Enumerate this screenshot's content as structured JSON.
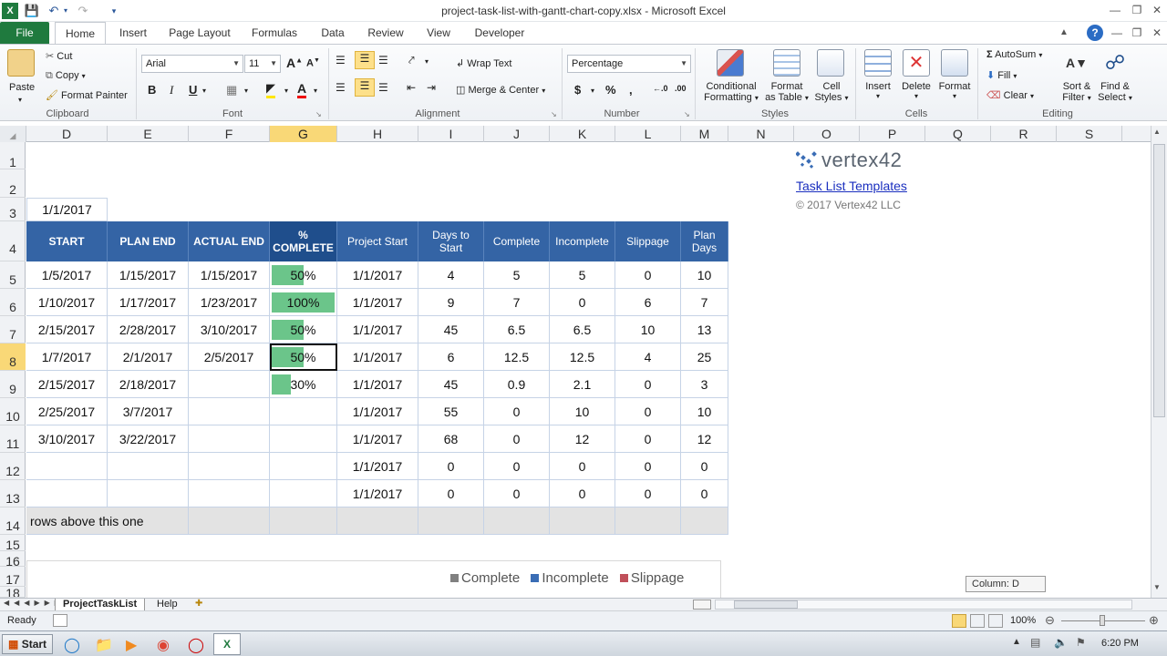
{
  "window": {
    "title": "project-task-list-with-gantt-chart-copy.xlsx - Microsoft Excel"
  },
  "ribbon_tabs": [
    "File",
    "Home",
    "Insert",
    "Page Layout",
    "Formulas",
    "Data",
    "Review",
    "View",
    "Developer"
  ],
  "ribbon": {
    "clipboard": {
      "paste": "Paste",
      "cut": "Cut",
      "copy": "Copy",
      "format_painter": "Format Painter",
      "label": "Clipboard"
    },
    "font": {
      "name": "Arial",
      "size": "11",
      "label": "Font"
    },
    "alignment": {
      "wrap_text": "Wrap Text",
      "merge_center": "Merge & Center",
      "label": "Alignment"
    },
    "number": {
      "format": "Percentage",
      "label": "Number"
    },
    "styles": {
      "conditional": "Conditional",
      "conditional2": "Formatting",
      "format_as": "Format",
      "format_as2": "as Table",
      "cell": "Cell",
      "cell2": "Styles",
      "label": "Styles"
    },
    "cells": {
      "insert": "Insert",
      "delete": "Delete",
      "format": "Format",
      "label": "Cells"
    },
    "editing": {
      "autosum": "AutoSum",
      "fill": "Fill",
      "clear": "Clear",
      "sort": "Sort &",
      "sort2": "Filter",
      "find": "Find &",
      "find2": "Select",
      "label": "Editing"
    }
  },
  "columns": [
    "D",
    "E",
    "F",
    "G",
    "H",
    "I",
    "J",
    "K",
    "L",
    "M",
    "N",
    "O",
    "P",
    "Q",
    "R",
    "S"
  ],
  "rows": [
    "1",
    "2",
    "3",
    "4",
    "5",
    "6",
    "7",
    "8",
    "9",
    "10",
    "11",
    "12",
    "13",
    "14",
    "15",
    "16",
    "17",
    "18"
  ],
  "vertex": {
    "logo": "vertex42",
    "link": "Task List Templates",
    "copyright": "© 2017 Vertex42 LLC"
  },
  "date_cell": "1/1/2017",
  "table_headers": {
    "start": "START",
    "plan_end": "PLAN END",
    "actual_end": "ACTUAL END",
    "pct_a": "%",
    "pct_b": "COMPLETE",
    "project_start": "Project Start",
    "days_a": "Days to",
    "days_b": "Start",
    "complete": "Complete",
    "incomplete": "Incomplete",
    "slippage": "Slippage",
    "plan_a": "Plan",
    "plan_b": "Days"
  },
  "table_rows": [
    {
      "start": "1/5/2017",
      "plan_end": "1/15/2017",
      "actual_end": "1/15/2017",
      "pct": "50%",
      "pct_value": 0.5,
      "project_start": "1/1/2017",
      "days": "4",
      "complete": "5",
      "incomplete": "5",
      "slippage": "0",
      "plan_days": "10"
    },
    {
      "start": "1/10/2017",
      "plan_end": "1/17/2017",
      "actual_end": "1/23/2017",
      "pct": "100%",
      "pct_value": 1.0,
      "project_start": "1/1/2017",
      "days": "9",
      "complete": "7",
      "incomplete": "0",
      "slippage": "6",
      "plan_days": "7"
    },
    {
      "start": "2/15/2017",
      "plan_end": "2/28/2017",
      "actual_end": "3/10/2017",
      "pct": "50%",
      "pct_value": 0.5,
      "project_start": "1/1/2017",
      "days": "45",
      "complete": "6.5",
      "incomplete": "6.5",
      "slippage": "10",
      "plan_days": "13"
    },
    {
      "start": "1/7/2017",
      "plan_end": "2/1/2017",
      "actual_end": "2/5/2017",
      "pct": "50%",
      "pct_value": 0.5,
      "project_start": "1/1/2017",
      "days": "6",
      "complete": "12.5",
      "incomplete": "12.5",
      "slippage": "4",
      "plan_days": "25"
    },
    {
      "start": "2/15/2017",
      "plan_end": "2/18/2017",
      "actual_end": "",
      "pct": "30%",
      "pct_value": 0.3,
      "project_start": "1/1/2017",
      "days": "45",
      "complete": "0.9",
      "incomplete": "2.1",
      "slippage": "0",
      "plan_days": "3"
    },
    {
      "start": "2/25/2017",
      "plan_end": "3/7/2017",
      "actual_end": "",
      "pct": "",
      "pct_value": 0,
      "project_start": "1/1/2017",
      "days": "55",
      "complete": "0",
      "incomplete": "10",
      "slippage": "0",
      "plan_days": "10"
    },
    {
      "start": "3/10/2017",
      "plan_end": "3/22/2017",
      "actual_end": "",
      "pct": "",
      "pct_value": 0,
      "project_start": "1/1/2017",
      "days": "68",
      "complete": "0",
      "incomplete": "12",
      "slippage": "0",
      "plan_days": "12"
    },
    {
      "start": "",
      "plan_end": "",
      "actual_end": "",
      "pct": "",
      "pct_value": 0,
      "project_start": "1/1/2017",
      "days": "0",
      "complete": "0",
      "incomplete": "0",
      "slippage": "0",
      "plan_days": "0"
    },
    {
      "start": "",
      "plan_end": "",
      "actual_end": "",
      "pct": "",
      "pct_value": 0,
      "project_start": "1/1/2017",
      "days": "0",
      "complete": "0",
      "incomplete": "0",
      "slippage": "0",
      "plan_days": "0"
    }
  ],
  "footer_row_text": "rows above this one",
  "legend": {
    "complete": "Complete",
    "incomplete": "Incomplete",
    "slippage": "Slippage"
  },
  "colors": {
    "complete": "#808080",
    "incomplete": "#3a6db5",
    "slippage": "#c0505a",
    "header_blue": "#3464a5",
    "bar_green": "#6bc58a"
  },
  "name_box_tooltip": "Column: D",
  "sheet_tabs": [
    "ProjectTaskList",
    "Help"
  ],
  "status": {
    "ready": "Ready",
    "zoom": "100%"
  },
  "taskbar": {
    "start": "Start",
    "time": "6:20 PM"
  }
}
